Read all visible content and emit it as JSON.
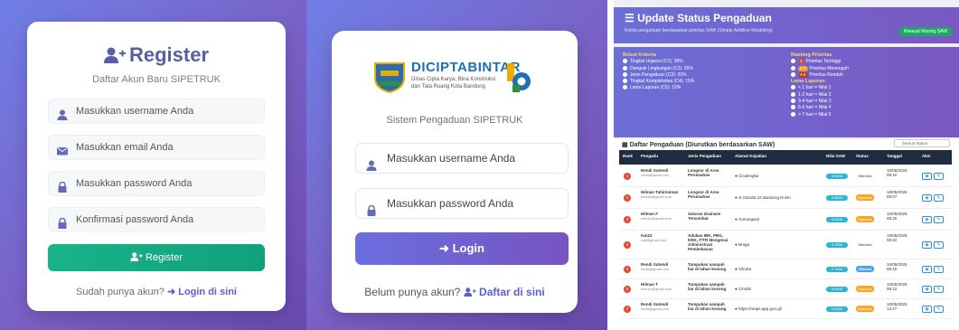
{
  "register": {
    "title": "Register",
    "subtitle": "Daftar Akun Baru SIPETRUK",
    "username_placeholder": "Masukkan username Anda",
    "email_placeholder": "Masukkan email Anda",
    "password_placeholder": "Masukkan password Anda",
    "confirm_placeholder": "Konfirmasi password Anda",
    "button": "Register",
    "footer_text": "Sudah punya akun?",
    "footer_link": "Login di sini"
  },
  "login": {
    "logo_title": "DICIPTABINTAR",
    "logo_sub": "Dinas Cipta Karya, Bina Konstruksi dan Tata Ruang Kota Bandung",
    "subtitle": "Sistem Pengaduan SIPETRUK",
    "username_placeholder": "Masukkan username Anda",
    "password_placeholder": "Masukkan password Anda",
    "button": "Login",
    "footer_text": "Belum punya akun?",
    "footer_link": "Daftar di sini"
  },
  "dashboard": {
    "title": "Update Status Pengaduan",
    "subtitle": "Kelola pengaduan berdasarkan prioritas SAW (Simple Additive Weighting)",
    "header_button": "Riwayat Masing SAW",
    "bobot_title": "Bobot Kriteria",
    "bobot_items": [
      "Tingkat Urgensi (C1): 30%",
      "Dampak Lingkungan (C2): 25%",
      "Jenis Pengaduan (C3): 20%",
      "Tingkat Kompleksitas (C4): 15%",
      "Lama Laporan (C5): 10%"
    ],
    "ranking_title": "Ranking Prioritas",
    "ranking_items": [
      {
        "pill": "1",
        "text": "Prioritas Tertinggi"
      },
      {
        "pill": "2-3",
        "text": "Prioritas Menengah"
      },
      {
        "pill": "4-5",
        "text": "Prioritas Rendah"
      }
    ],
    "lama_title": "Lama Laporan",
    "lama_items": [
      "< 1 hari = Nilai 1",
      "1-2 hari = Nilai 2",
      "3-4 hari = Nilai 3",
      "5-6 hari = Nilai 4",
      "> 7 hari = Nilai 5"
    ],
    "table_title": "Daftar Pengaduan (Diurutkan berdasarkan SAW)",
    "filter": "Semua Status",
    "columns": [
      "Rank",
      "Pengadu",
      "Jenis Pengaduan",
      "Alamat Kejadian",
      "Nilai SAW",
      "Status",
      "Tanggal",
      "Aksi"
    ],
    "rows": [
      {
        "rank": "1",
        "name": "Rendi Sutendi",
        "sub": "rendi@gmail.com",
        "jenis": "Longsor di Area Perumahan",
        "alamat": "Cicalengka",
        "score": "0.9600",
        "status": "Diterima",
        "st": "n",
        "date": "10/05/2025",
        "time": "09:10"
      },
      {
        "rank": "2",
        "name": "Hilman Tahirmiman",
        "sub": "hilman@gmail.com",
        "jenis": "Longsor di Area Perumahan",
        "alamat": "Jl Garuda 24 Bandung Kulon",
        "score": "0.8600",
        "status": "Diproses",
        "st": "p",
        "date": "10/05/2025",
        "time": "09:07"
      },
      {
        "rank": "3",
        "name": "Hilman F",
        "sub": "hilman@gmail.com",
        "jenis": "Saluran drainase Tersumbat",
        "alamat": "Gunungsari",
        "score": "0.8200",
        "status": "Diproses",
        "st": "p",
        "date": "10/05/2025",
        "time": "08:40"
      },
      {
        "rank": "4",
        "name": "Ivai23",
        "sub": "ivai@gmail.com",
        "jenis": "Adukan IBK, PBG, KRK, ITTR Mengenai Administrasi Pembebasan",
        "alamat": "Braga",
        "score": "0.7800",
        "status": "Diterima",
        "st": "n",
        "date": "10/05/2025",
        "time": "08:32"
      },
      {
        "rank": "5",
        "name": "Rendi Sutendi",
        "sub": "rendi@gmail.com",
        "jenis": "Tumpukan sampah liar di lahan kosong",
        "alamat": "Cikutra",
        "score": "0.7400",
        "status": "Selesai",
        "st": "b",
        "date": "10/05/2025",
        "time": "08:16"
      },
      {
        "rank": "6",
        "name": "Hilman T",
        "sub": "hilman@gmail.com",
        "jenis": "Tumpukan sampah liar di lahan kosong",
        "alamat": "Cimahi",
        "score": "0.6900",
        "status": "Diproses",
        "st": "p",
        "date": "10/05/2025",
        "time": "08:12"
      },
      {
        "rank": "7",
        "name": "Rendi Sutendi",
        "sub": "rendi@gmail.com",
        "jenis": "Tumpukan sampah liar di lahan kosong",
        "alamat": "https://maps.app.goo.gl/",
        "score": "0.6300",
        "status": "Diproses",
        "st": "p",
        "date": "10/05/2025",
        "time": "14:27"
      }
    ]
  }
}
